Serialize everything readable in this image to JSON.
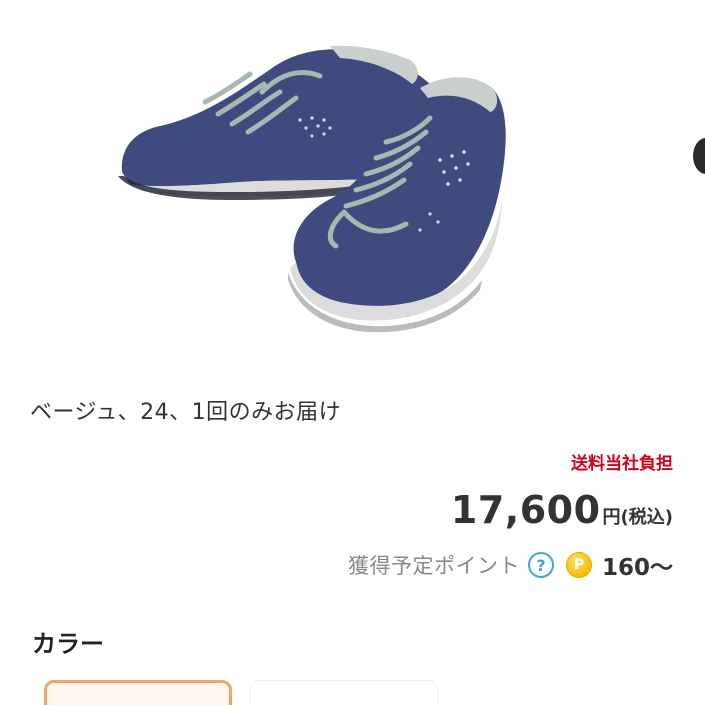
{
  "product": {
    "image_alt": "navy suede sneakers pair",
    "variant_summary": "ベージュ、24、1回のみお届け",
    "shipping_note": "送料当社負担",
    "price": "17,600",
    "price_unit": "円(税込)",
    "points_label": "獲得予定ポイント",
    "help_icon_glyph": "?",
    "point_coin_glyph": "P",
    "points_value": "160〜"
  },
  "color_section": {
    "heading": "カラー"
  },
  "colors": {
    "shoe_main": "#3f4a7e",
    "sole": "#dcdcdc",
    "laces": "#a9b7b1",
    "price_red": "#d0021b",
    "help_blue": "#3aa7d8",
    "coin_gold": "#f5b800",
    "swatch_selected_border": "#f4a460"
  }
}
